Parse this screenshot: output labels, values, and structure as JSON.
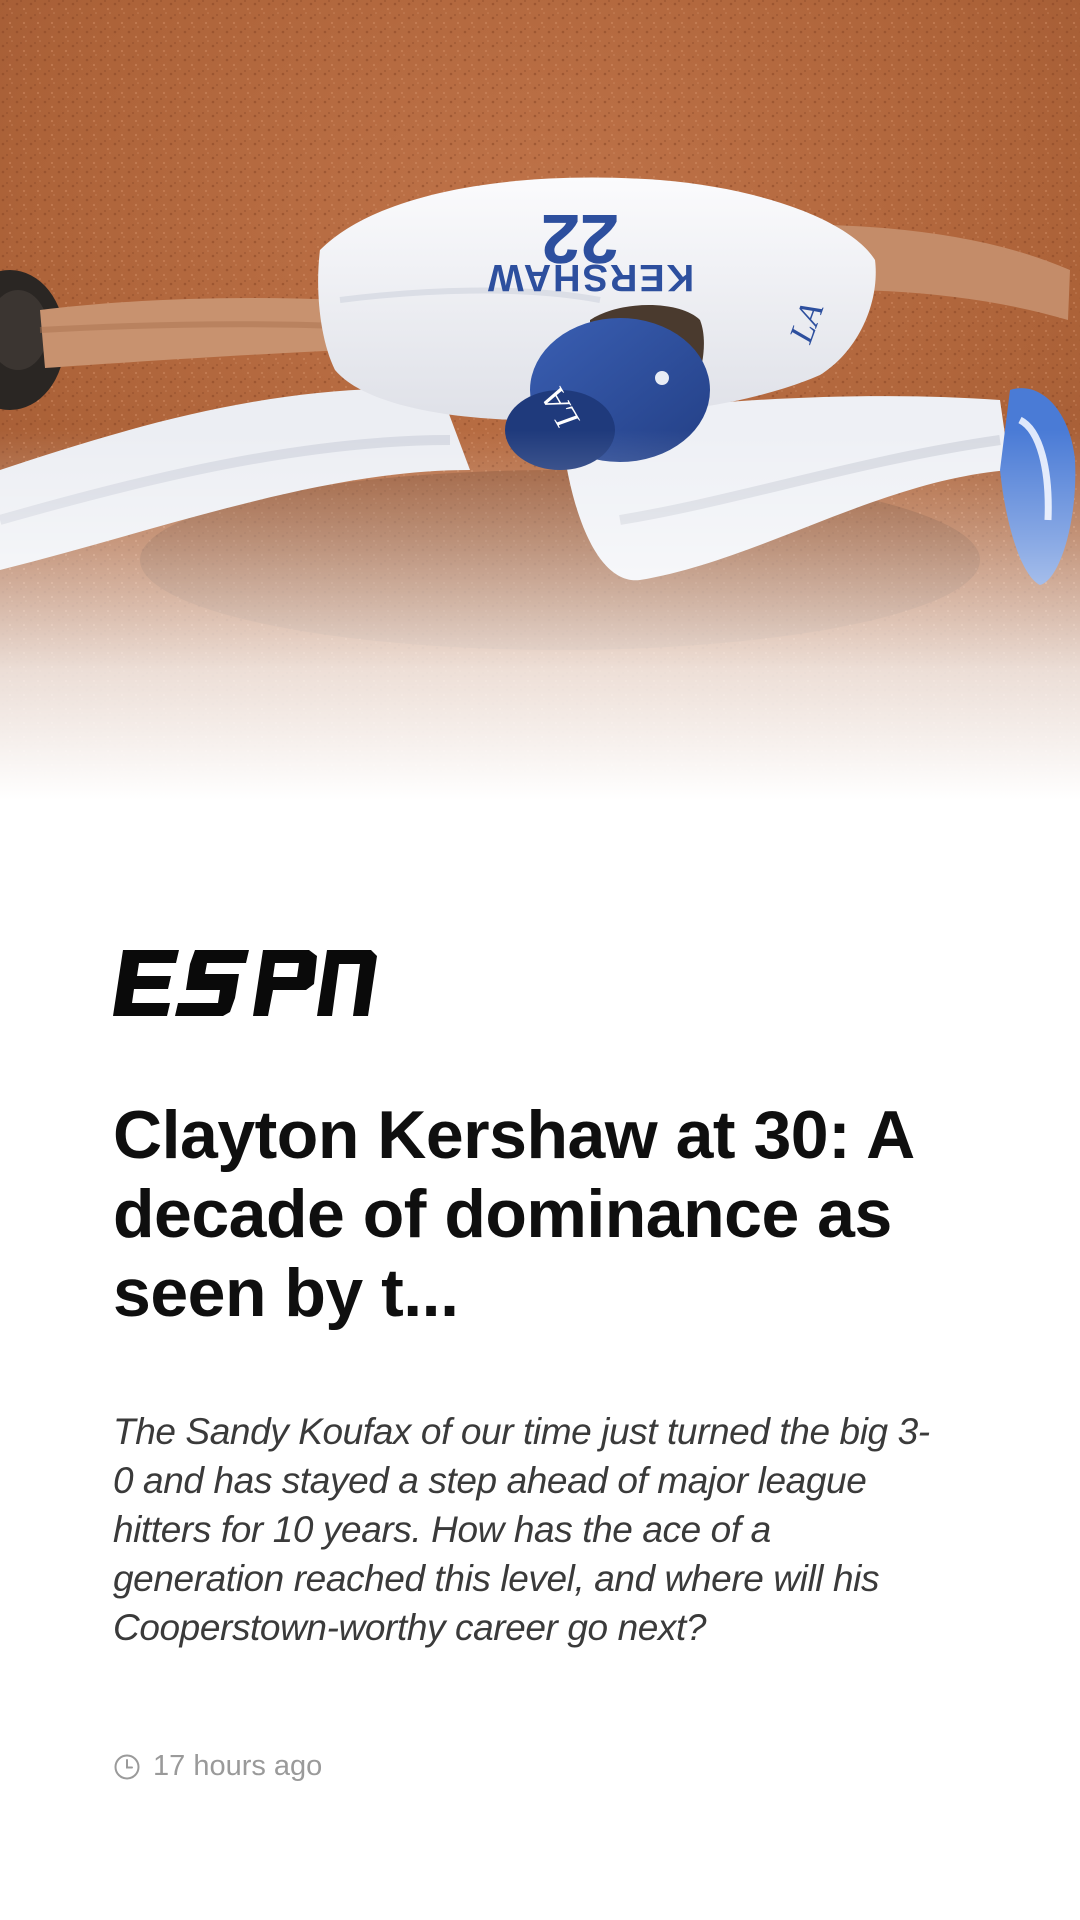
{
  "article": {
    "source": "ESPN",
    "headline": "Clayton Kershaw at 30: A decade of dominance as seen by t...",
    "summary": "The Sandy Koufax of our time just turned the big 3-0 and has stayed a step ahead of major league hitters for 10 years. How has the ace of a generation reached this level, and where will his Cooperstown-worthy career go next?",
    "timestamp": "17 hours ago",
    "timestamp_icon": "clock-icon"
  },
  "hero": {
    "jersey_name": "KERSHAW",
    "jersey_number": "22",
    "cap_logo": "LA",
    "colors": {
      "dirt": "#b5673a",
      "jersey": "#f4f4f6",
      "team_blue": "#2d4f9e"
    }
  },
  "theme": {
    "headline_color": "#0f0f0f",
    "summary_color": "#3a3a3a",
    "meta_color": "#9a9a9a"
  }
}
